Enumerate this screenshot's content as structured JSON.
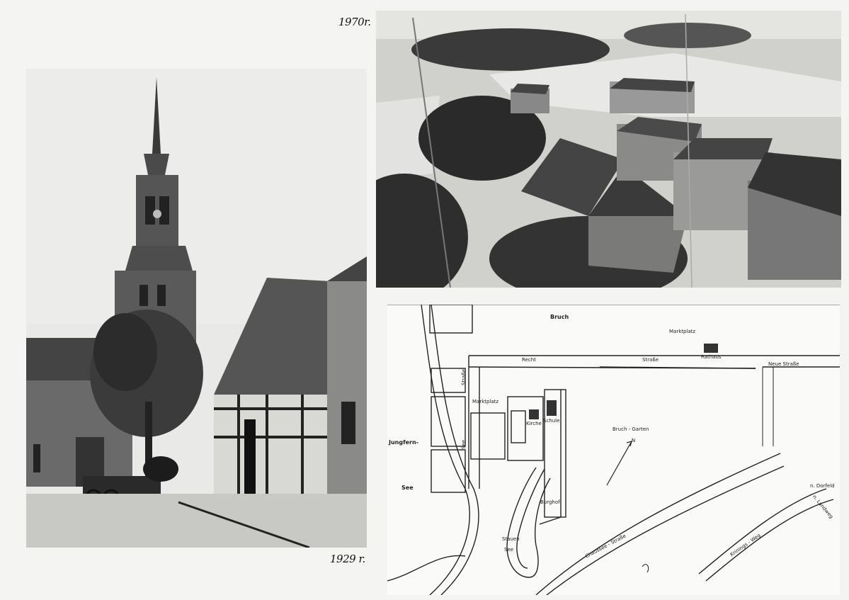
{
  "captions": {
    "top_year": "1970r.",
    "bottom_year": "1929 r."
  },
  "map": {
    "labels": {
      "bruch": "Bruch",
      "marktplatz_top": "Marktplatz",
      "rathaus": "Rathaus",
      "recht": "Recht",
      "strasse_top": "Straße",
      "neue_strasse": "Neue Straße",
      "strasse_left": "Straße",
      "marktplatz": "Marktplatz",
      "kirche": "Kirche",
      "schule": "Schule",
      "bruch_garten": "Bruch - Garten",
      "north": "N",
      "jungfern": "Jungfern-",
      "see_left": "See",
      "see_vertical": "See",
      "burghof": "Burghof",
      "stauen": "Stauen",
      "see_bottom": "See",
      "chaussee": "Chaussee - Straße",
      "krinings": "Krinings - Weg",
      "n_dorf": "n. Dorfeld",
      "n_landweg": "n. Landweg"
    }
  },
  "colors": {
    "paper": "#f4f4f2",
    "ink": "#111111"
  }
}
